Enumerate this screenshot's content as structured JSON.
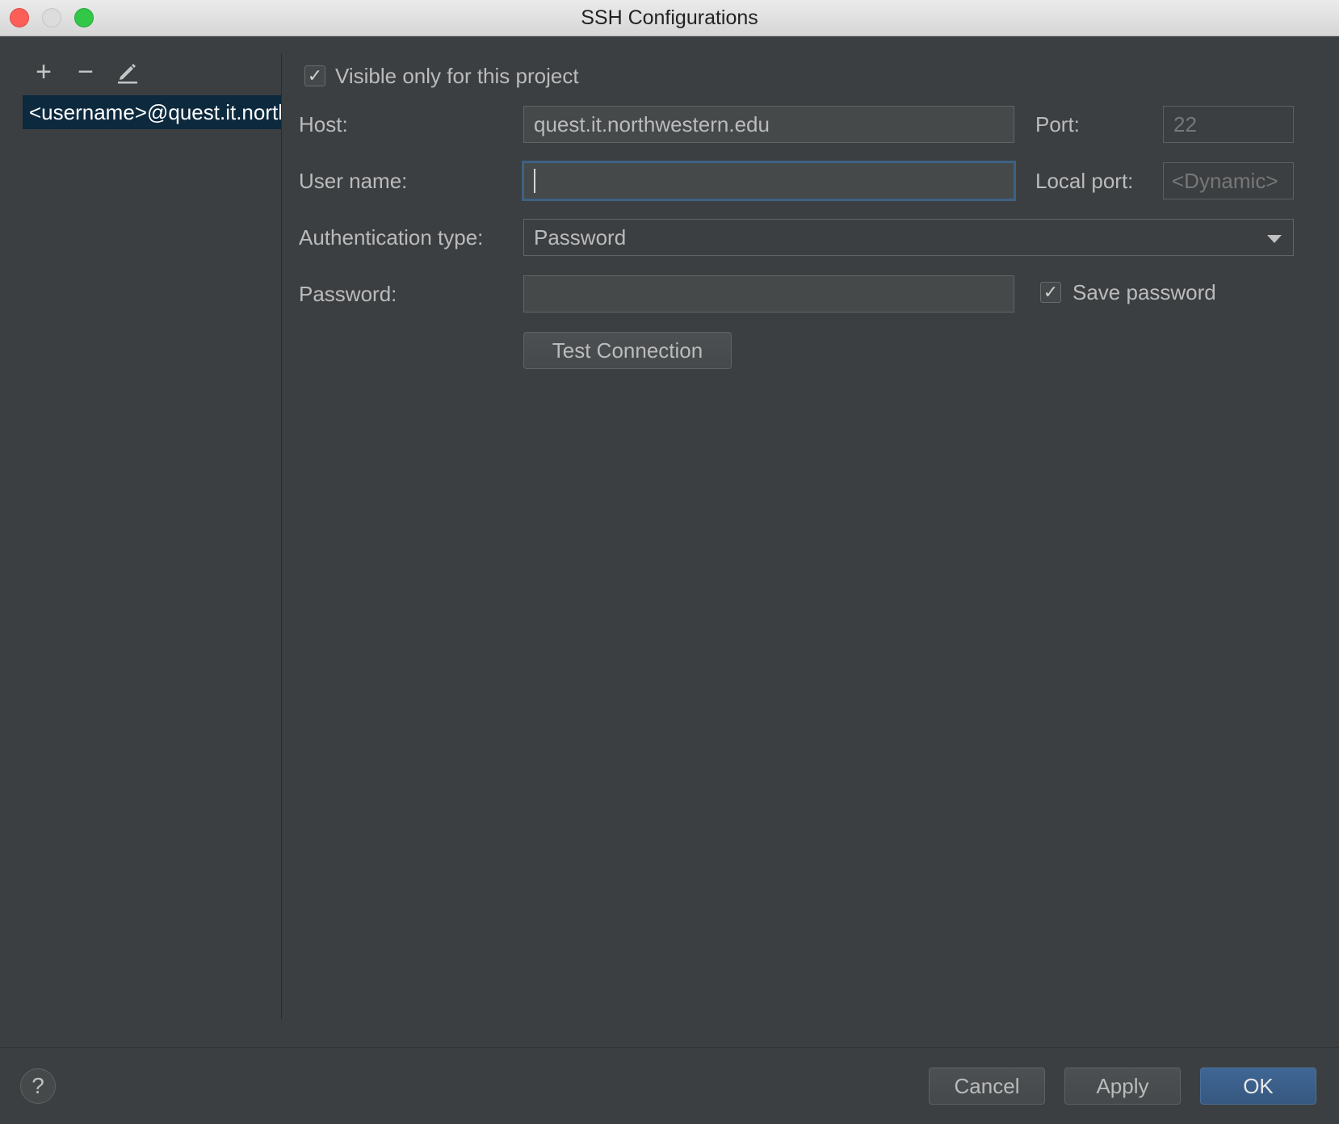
{
  "window": {
    "title": "SSH Configurations"
  },
  "toolbar": {
    "add_glyph": "+",
    "remove_glyph": "−",
    "edit_glyph": "✎"
  },
  "list": {
    "items": [
      {
        "label": "<username>@quest.it.northwestern.edu",
        "selected": true
      }
    ]
  },
  "form": {
    "visible_only": {
      "label": "Visible only for this project",
      "checked": true,
      "glyph": "✓"
    },
    "host": {
      "label": "Host:",
      "value": "quest.it.northwestern.edu"
    },
    "port": {
      "label": "Port:",
      "value": "22"
    },
    "username": {
      "label": "User name:",
      "value": ""
    },
    "local_port": {
      "label": "Local port:",
      "placeholder": "<Dynamic>"
    },
    "auth_type": {
      "label": "Authentication type:",
      "value": "Password"
    },
    "password": {
      "label": "Password:",
      "value": ""
    },
    "save_password": {
      "label": "Save password",
      "checked": true,
      "glyph": "✓"
    },
    "test_connection": "Test Connection"
  },
  "footer": {
    "help": "?",
    "cancel": "Cancel",
    "apply": "Apply",
    "ok": "OK"
  },
  "colors": {
    "background": "#3c3f41",
    "selection": "#0d293e",
    "focus_border": "#3d6185",
    "primary_button": "#365880"
  }
}
